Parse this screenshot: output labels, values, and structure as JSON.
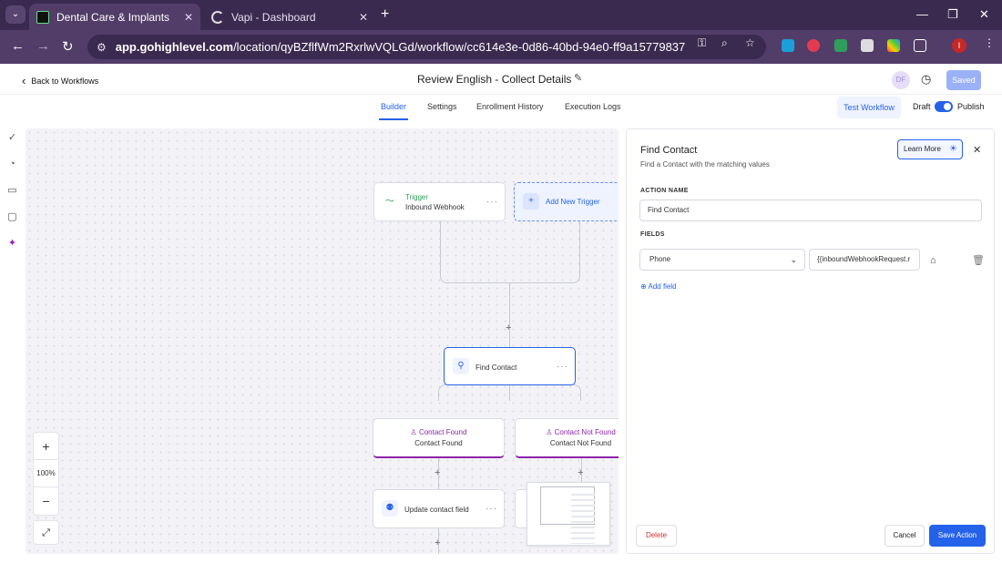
{
  "browser": {
    "tabs": [
      {
        "title": "Dental Care & Implants"
      },
      {
        "title": "Vapi - Dashboard"
      }
    ],
    "url_host": "app.gohighlevel.com",
    "url_path": "/location/qyBZflfWm2RxrlwVQLGd/workflow/cc614e3e-0d86-40bd-94e0-ff9a15779837",
    "profile_initial": "I"
  },
  "header": {
    "back_label": "Back to Workflows",
    "workflow_title": "Review English - Collect Details",
    "avatar_initials": "DF",
    "saved_label": "Saved"
  },
  "subnav": {
    "tabs": [
      "Builder",
      "Settings",
      "Enrollment History",
      "Execution Logs"
    ],
    "active_tab": "Builder",
    "test_label": "Test Workflow",
    "draft_label": "Draft",
    "publish_label": "Publish",
    "published": true
  },
  "canvas": {
    "trigger": {
      "title": "Trigger",
      "subtitle": "Inbound Webhook"
    },
    "add_trigger_label": "Add New Trigger",
    "find_contact_label": "Find Contact",
    "branches": [
      {
        "title": "Contact Found",
        "subtitle": "Contact Found"
      },
      {
        "title": "Contact Not Found",
        "subtitle": "Contact Not Found"
      }
    ],
    "update_label": "Update contact field",
    "zoom_level": "100%"
  },
  "panel": {
    "title": "Find Contact",
    "subtitle": "Find a Contact with the matching values",
    "learn_more": "Learn More",
    "action_name_label": "ACTION NAME",
    "action_name_value": "Find Contact",
    "fields_label": "FIELDS",
    "field_select_value": "Phone",
    "field_value": "{{inboundWebhookRequest.r",
    "add_field_label": "Add field",
    "delete_label": "Delete",
    "cancel_label": "Cancel",
    "save_label": "Save Action"
  },
  "colors": {
    "accent": "#2562ea",
    "chrome": "#523d69",
    "purple_branch": "#8e24aa",
    "delete": "#d32f2f"
  }
}
